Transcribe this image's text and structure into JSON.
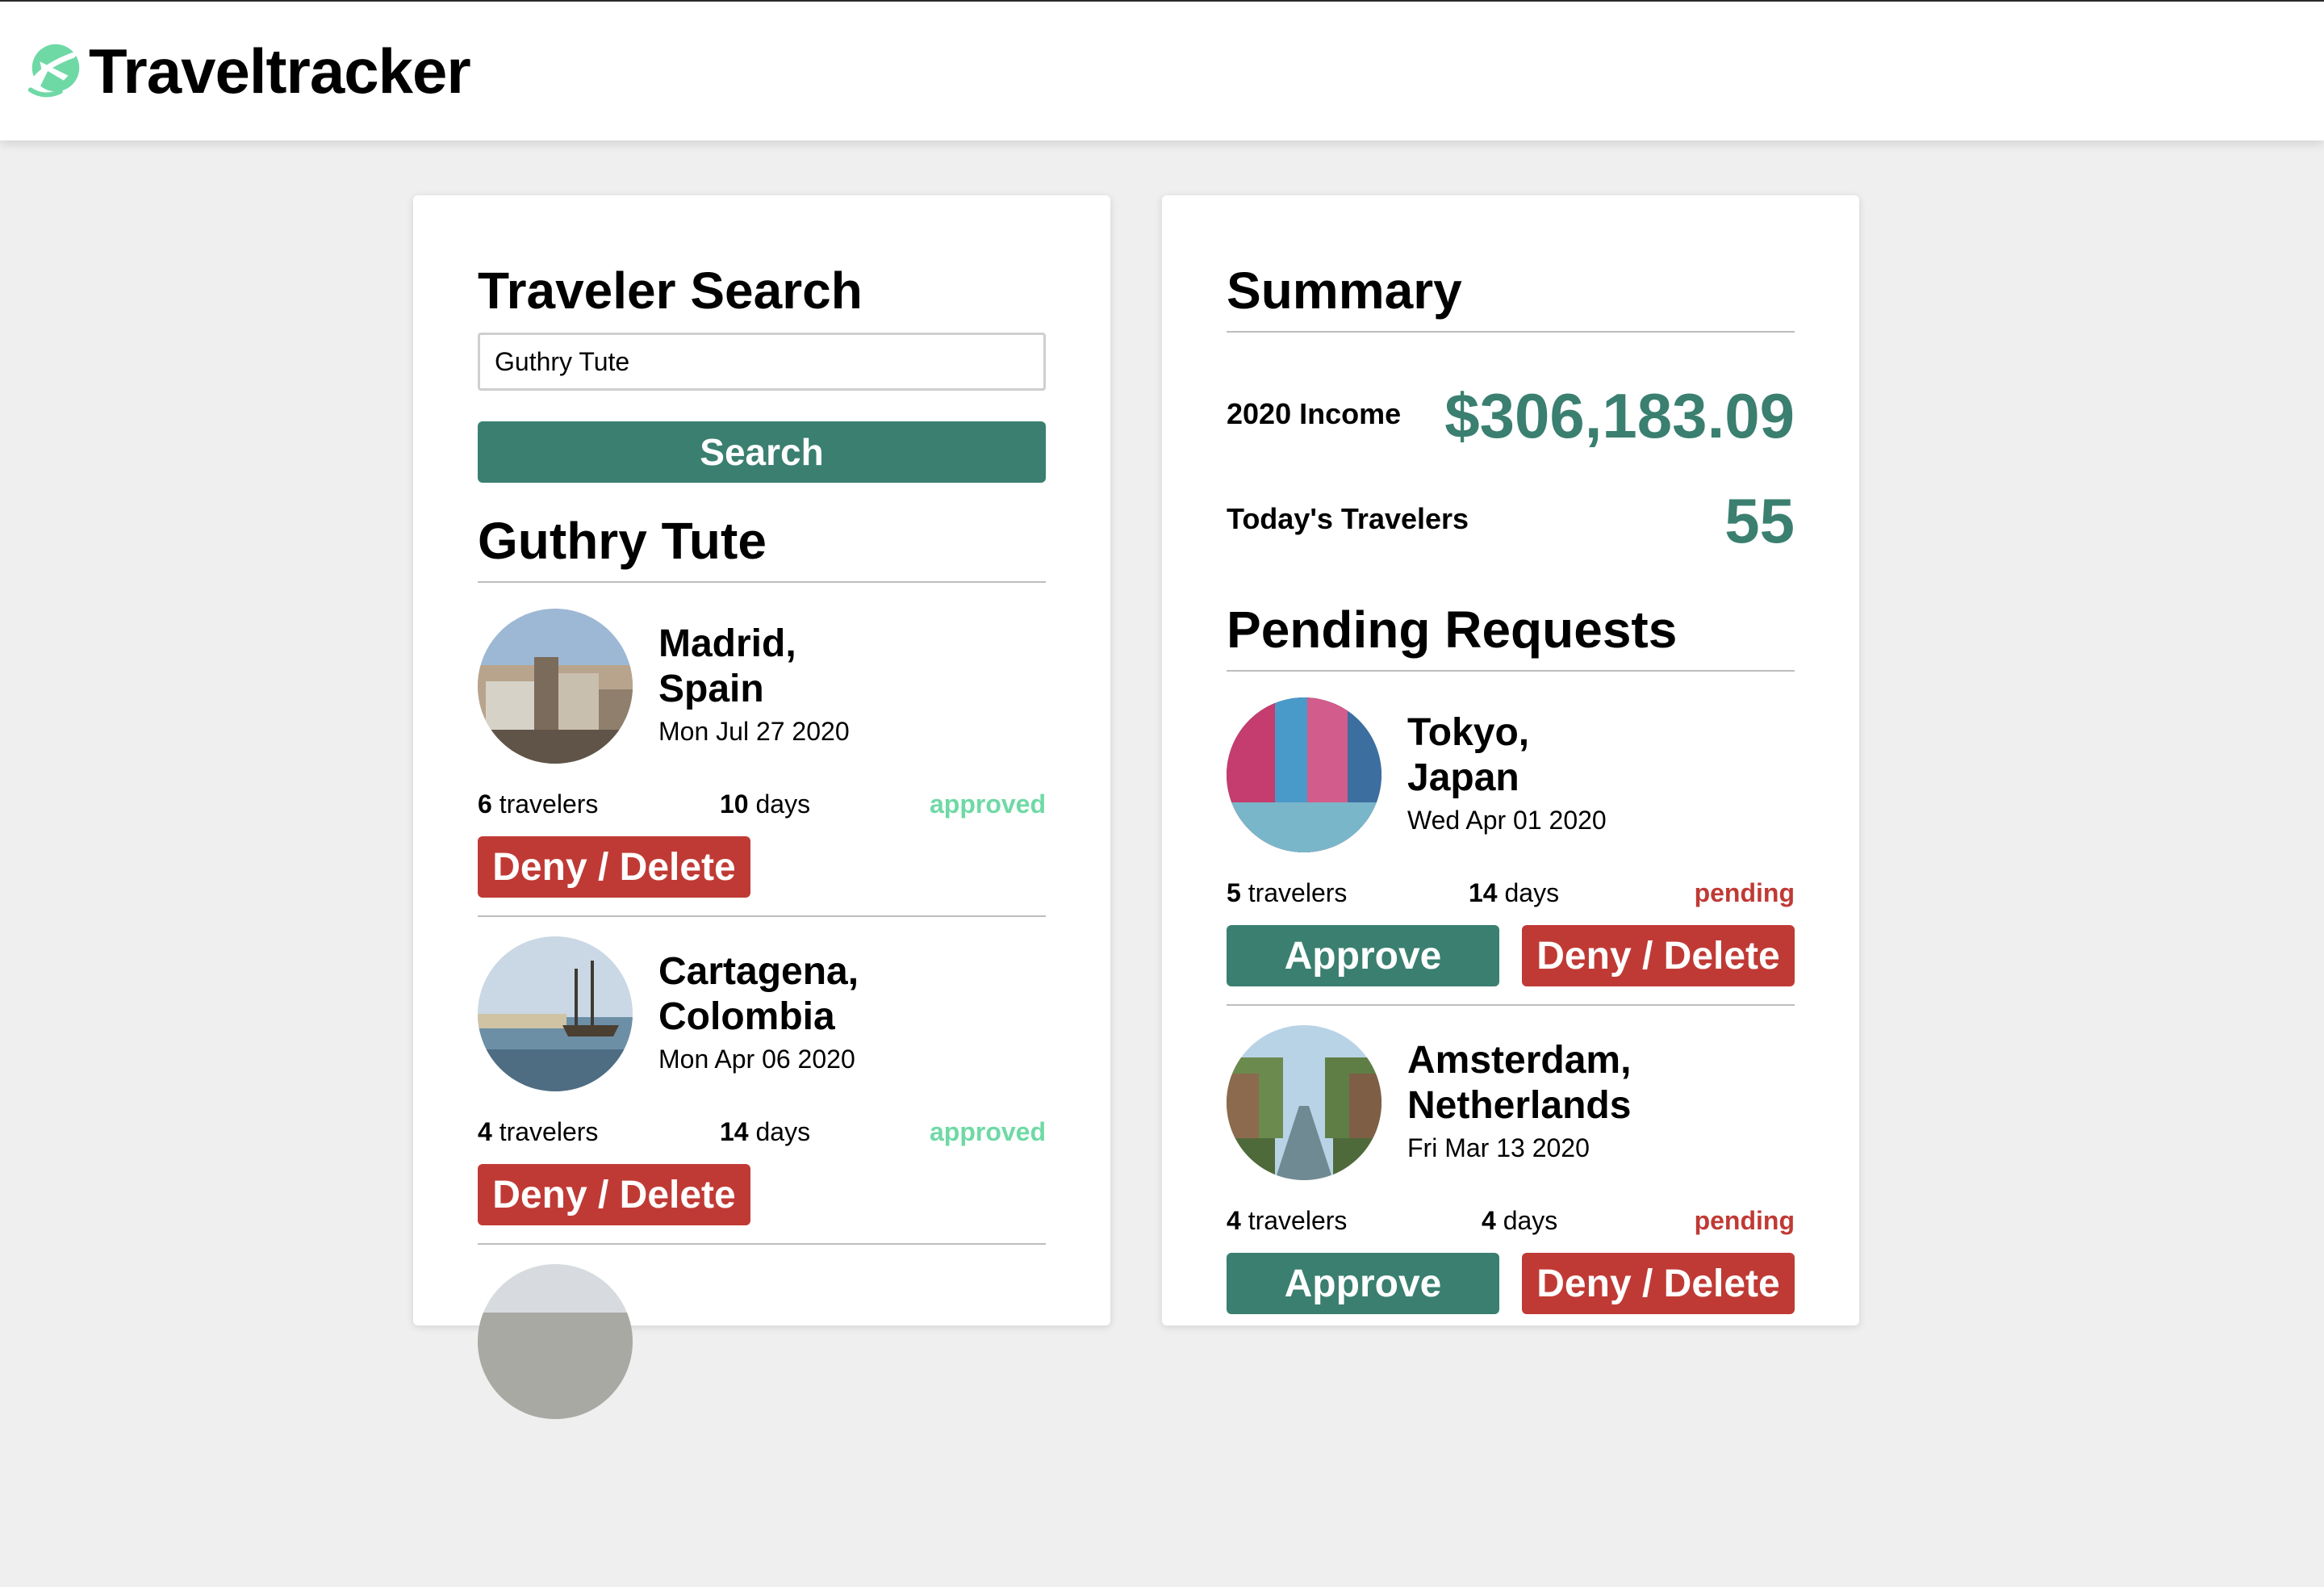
{
  "app": {
    "name": "Traveltracker"
  },
  "search_panel": {
    "title": "Traveler Search",
    "input_value": "Guthry Tute",
    "search_label": "Search",
    "traveler_name": "Guthry Tute",
    "trips": [
      {
        "destination": "Madrid,\nSpain",
        "date": "Mon Jul 27 2020",
        "travelers_count": "6",
        "travelers_word": " travelers",
        "days_count": "10",
        "days_word": " days",
        "status": "approved",
        "deny_label": "Deny / Delete"
      },
      {
        "destination": "Cartagena,\nColombia",
        "date": "Mon Apr 06 2020",
        "travelers_count": "4",
        "travelers_word": " travelers",
        "days_count": "14",
        "days_word": " days",
        "status": "approved",
        "deny_label": "Deny / Delete"
      }
    ]
  },
  "summary_panel": {
    "title": "Summary",
    "income_label": "2020 Income",
    "income_value": "$306,183.09",
    "travelers_label": "Today's Travelers",
    "travelers_value": "55",
    "pending_title": "Pending Requests",
    "requests": [
      {
        "destination": "Tokyo,\nJapan",
        "date": "Wed Apr 01 2020",
        "travelers_count": "5",
        "travelers_word": " travelers",
        "days_count": "14",
        "days_word": " days",
        "status": "pending",
        "approve_label": "Approve",
        "deny_label": "Deny / Delete"
      },
      {
        "destination": "Amsterdam,\nNetherlands",
        "date": "Fri Mar 13 2020",
        "travelers_count": "4",
        "travelers_word": " travelers",
        "days_count": "4",
        "days_word": " days",
        "status": "pending",
        "approve_label": "Approve",
        "deny_label": "Deny / Delete"
      }
    ]
  },
  "colors": {
    "primary": "#3a7f70",
    "danger": "#c03a35",
    "approved": "#6fd9a6",
    "logo": "#6fd9a6"
  },
  "icons": {
    "logo": "globe-airplane-icon"
  }
}
